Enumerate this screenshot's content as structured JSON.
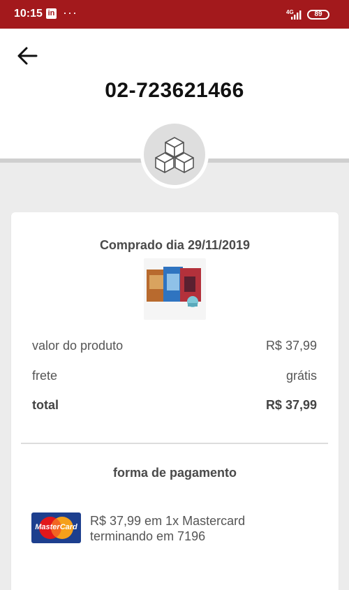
{
  "status_bar": {
    "time": "10:15",
    "app_icon": "linkedin-icon",
    "more": "···",
    "network": "4G",
    "battery": "89"
  },
  "header": {
    "order_number": "02-723621466",
    "back_icon": "arrow-left-icon",
    "badge_icon": "boxes-icon"
  },
  "order": {
    "purchased_label": "Comprado dia 29/11/2019",
    "product_image": "book-box-set-thumbnail",
    "rows": [
      {
        "label": "valor do produto",
        "value": "R$ 37,99"
      },
      {
        "label": "frete",
        "value": "grátis"
      },
      {
        "label": "total",
        "value": "R$ 37,99"
      }
    ]
  },
  "payment": {
    "title": "forma de pagamento",
    "card_brand": "MasterCard",
    "line1": "R$ 37,99 em 1x Mastercard",
    "line2": "terminando em 7196"
  },
  "colors": {
    "status_bar": "#a3191c",
    "background": "#ececec",
    "card": "#ffffff"
  }
}
